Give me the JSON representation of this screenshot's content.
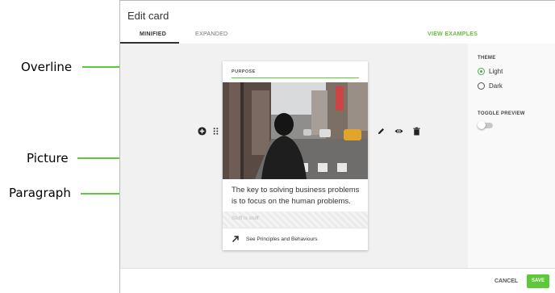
{
  "annotations": {
    "overline": "Overline",
    "picture": "Picture",
    "paragraph": "Paragraph"
  },
  "dialog": {
    "title": "Edit card",
    "tabs": [
      {
        "label": "MINIFIED",
        "active": true
      },
      {
        "label": "EXPANDED",
        "active": false
      }
    ],
    "view_examples": "VIEW EXAMPLES"
  },
  "card": {
    "overline": "PURPOSE",
    "picture_icon": "street-photo",
    "paragraph": "The key to solving business problems is to focus on the human problems.",
    "stuff_placeholder": "Stuff is stuff",
    "link_label": "See Principles and Behaviours",
    "link_icon": "arrow-up-right-icon"
  },
  "card_tools": {
    "left": [
      "add-circle-icon",
      "drag-handle-icon"
    ],
    "right": [
      "pencil-icon",
      "eye-icon",
      "trash-icon"
    ]
  },
  "settings": {
    "theme_heading": "THEME",
    "theme_options": [
      {
        "label": "Light",
        "selected": true
      },
      {
        "label": "Dark",
        "selected": false
      }
    ],
    "toggle_heading": "TOGGLE PREVIEW",
    "toggle_on": false
  },
  "footer": {
    "cancel": "CANCEL",
    "save": "SAVE"
  },
  "colors": {
    "accent": "#5cc83a",
    "radio_selected": "#4caf50"
  }
}
